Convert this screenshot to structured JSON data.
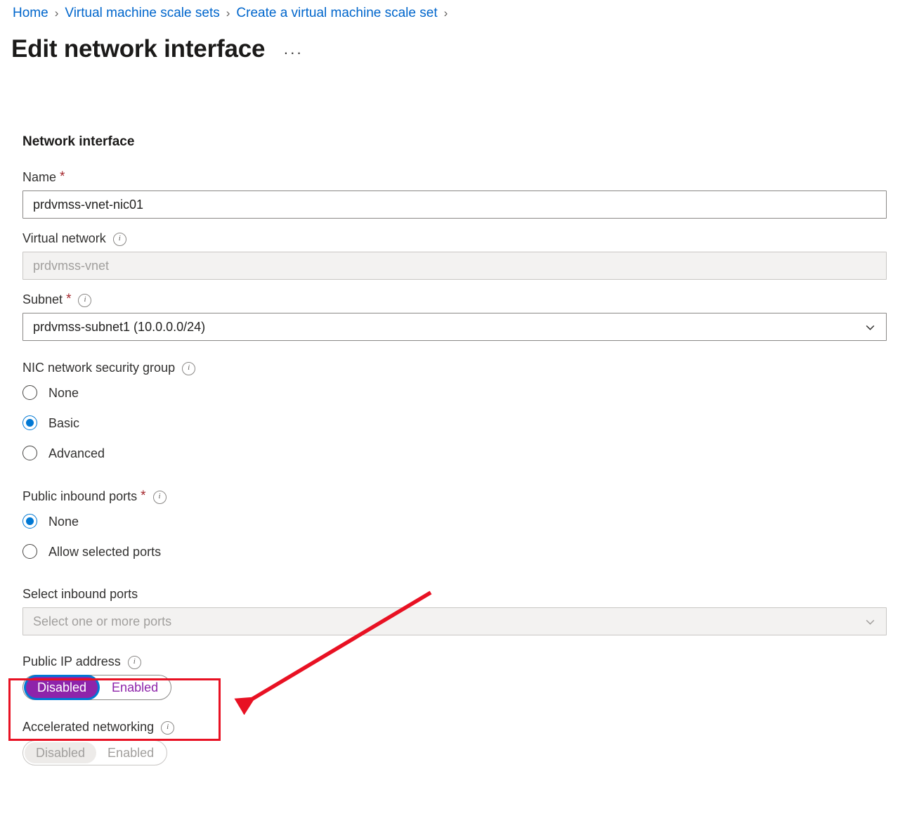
{
  "breadcrumb": {
    "items": [
      {
        "label": "Home"
      },
      {
        "label": "Virtual machine scale sets"
      },
      {
        "label": "Create a virtual machine scale set"
      }
    ],
    "separator": "›"
  },
  "header": {
    "title": "Edit network interface",
    "more_menu": "···"
  },
  "form": {
    "section_title": "Network interface",
    "name": {
      "label": "Name",
      "required": "*",
      "value": "prdvmss-vnet-nic01"
    },
    "virtual_network": {
      "label": "Virtual network",
      "info": "info-icon",
      "value": "prdvmss-vnet",
      "disabled": true
    },
    "subnet": {
      "label": "Subnet",
      "required": "*",
      "info": "info-icon",
      "value": "prdvmss-subnet1 (10.0.0.0/24)"
    },
    "nic_nsg": {
      "label": "NIC network security group",
      "info": "info-icon",
      "options": [
        {
          "label": "None",
          "selected": false
        },
        {
          "label": "Basic",
          "selected": true
        },
        {
          "label": "Advanced",
          "selected": false
        }
      ]
    },
    "public_inbound_ports": {
      "label": "Public inbound ports",
      "required": "*",
      "info": "info-icon",
      "options": [
        {
          "label": "None",
          "selected": true
        },
        {
          "label": "Allow selected ports",
          "selected": false
        }
      ]
    },
    "select_inbound_ports": {
      "label": "Select inbound ports",
      "placeholder": "Select one or more ports",
      "disabled": true
    },
    "public_ip_address": {
      "label": "Public IP address",
      "info": "info-icon",
      "options": [
        {
          "label": "Disabled",
          "selected": true
        },
        {
          "label": "Enabled",
          "selected": false
        }
      ]
    },
    "accelerated_networking": {
      "label": "Accelerated networking",
      "info": "info-icon",
      "disabled": true,
      "options": [
        {
          "label": "Disabled",
          "selected": true
        },
        {
          "label": "Enabled",
          "selected": false
        }
      ]
    }
  },
  "colors": {
    "link": "#0066cc",
    "accent": "#0078d4",
    "required": "#a4262c",
    "toggle_active": "#8e24aa",
    "annotation": "#e81123"
  }
}
